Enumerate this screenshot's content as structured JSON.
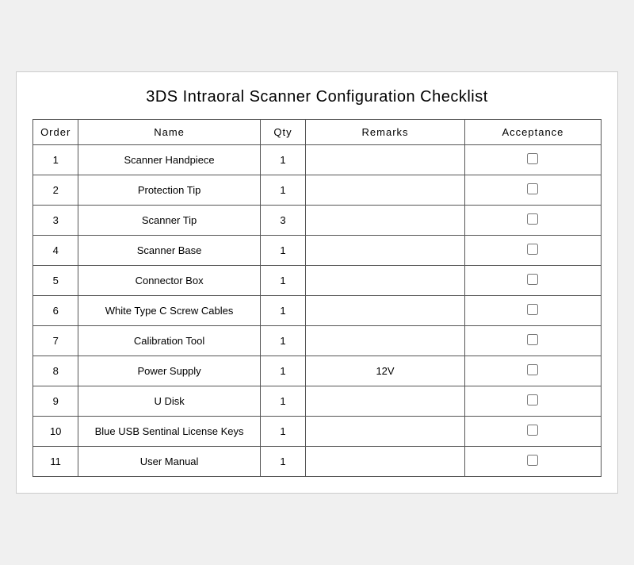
{
  "title": "3DS Intraoral Scanner Configuration Checklist",
  "columns": {
    "order": "Order",
    "name": "Name",
    "qty": "Qty",
    "remarks": "Remarks",
    "acceptance": "Acceptance"
  },
  "rows": [
    {
      "order": "1",
      "name": "Scanner Handpiece",
      "qty": "1",
      "remarks": ""
    },
    {
      "order": "2",
      "name": "Protection Tip",
      "qty": "1",
      "remarks": ""
    },
    {
      "order": "3",
      "name": "Scanner Tip",
      "qty": "3",
      "remarks": ""
    },
    {
      "order": "4",
      "name": "Scanner Base",
      "qty": "1",
      "remarks": ""
    },
    {
      "order": "5",
      "name": "Connector Box",
      "qty": "1",
      "remarks": ""
    },
    {
      "order": "6",
      "name": "White Type C Screw Cables",
      "qty": "1",
      "remarks": ""
    },
    {
      "order": "7",
      "name": "Calibration Tool",
      "qty": "1",
      "remarks": ""
    },
    {
      "order": "8",
      "name": "Power Supply",
      "qty": "1",
      "remarks": "12V"
    },
    {
      "order": "9",
      "name": "U Disk",
      "qty": "1",
      "remarks": ""
    },
    {
      "order": "10",
      "name": "Blue USB Sentinal License Keys",
      "qty": "1",
      "remarks": ""
    },
    {
      "order": "11",
      "name": "User Manual",
      "qty": "1",
      "remarks": ""
    }
  ]
}
